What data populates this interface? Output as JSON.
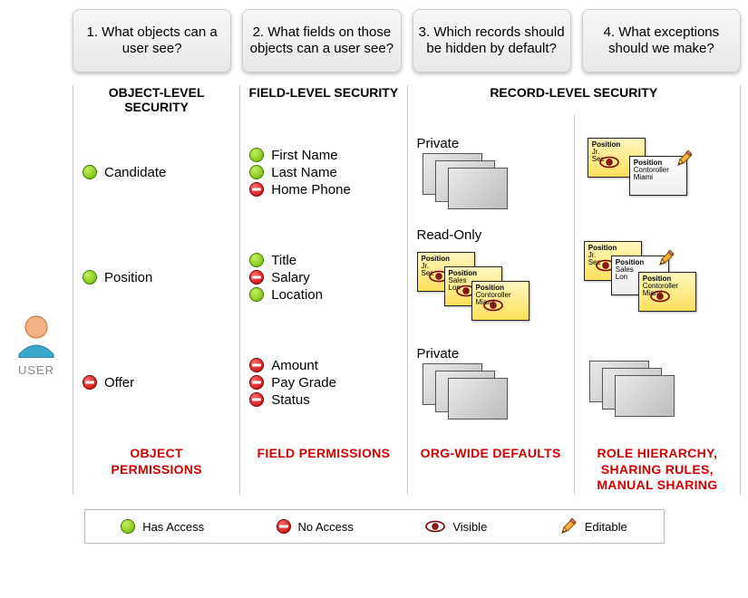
{
  "questions": [
    "1. What objects can a user see?",
    "2. What fields on those objects can a user see?",
    "3. Which records should be hidden by default?",
    "4. What exceptions should we make?"
  ],
  "user_label": "USER",
  "headers": {
    "col1": "OBJECT-LEVEL SECURITY",
    "col2": "FIELD-LEVEL SECURITY",
    "col34": "RECORD-LEVEL SECURITY"
  },
  "objects": [
    {
      "name": "Candidate",
      "access": true
    },
    {
      "name": "Position",
      "access": true
    },
    {
      "name": "Offer",
      "access": false
    }
  ],
  "fields": [
    [
      {
        "name": "First Name",
        "access": true
      },
      {
        "name": "Last Name",
        "access": true
      },
      {
        "name": "Home Phone",
        "access": false
      }
    ],
    [
      {
        "name": "Title",
        "access": true
      },
      {
        "name": "Salary",
        "access": false
      },
      {
        "name": "Location",
        "access": true
      }
    ],
    [
      {
        "name": "Amount",
        "access": false
      },
      {
        "name": "Pay Grade",
        "access": false
      },
      {
        "name": "Status",
        "access": false
      }
    ]
  ],
  "records": {
    "mode_labels": [
      "Private",
      "Read-Only",
      "Private"
    ],
    "note_cards": {
      "title_label": "Position",
      "cards": [
        {
          "line1": "Jr.",
          "line2": "Sec"
        },
        {
          "line1": "Sales",
          "line2": "Lon"
        },
        {
          "line1": "Contoroller",
          "line2": "Miami"
        }
      ]
    }
  },
  "footers": {
    "col1": "OBJECT PERMISSIONS",
    "col2": "FIELD PERMISSIONS",
    "col3": "ORG-WIDE DEFAULTS",
    "col4": "ROLE HIERARCHY, SHARING RULES, MANUAL SHARING"
  },
  "legend": {
    "access": "Has Access",
    "noaccess": "No Access",
    "visible": "Visible",
    "editable": "Editable"
  }
}
